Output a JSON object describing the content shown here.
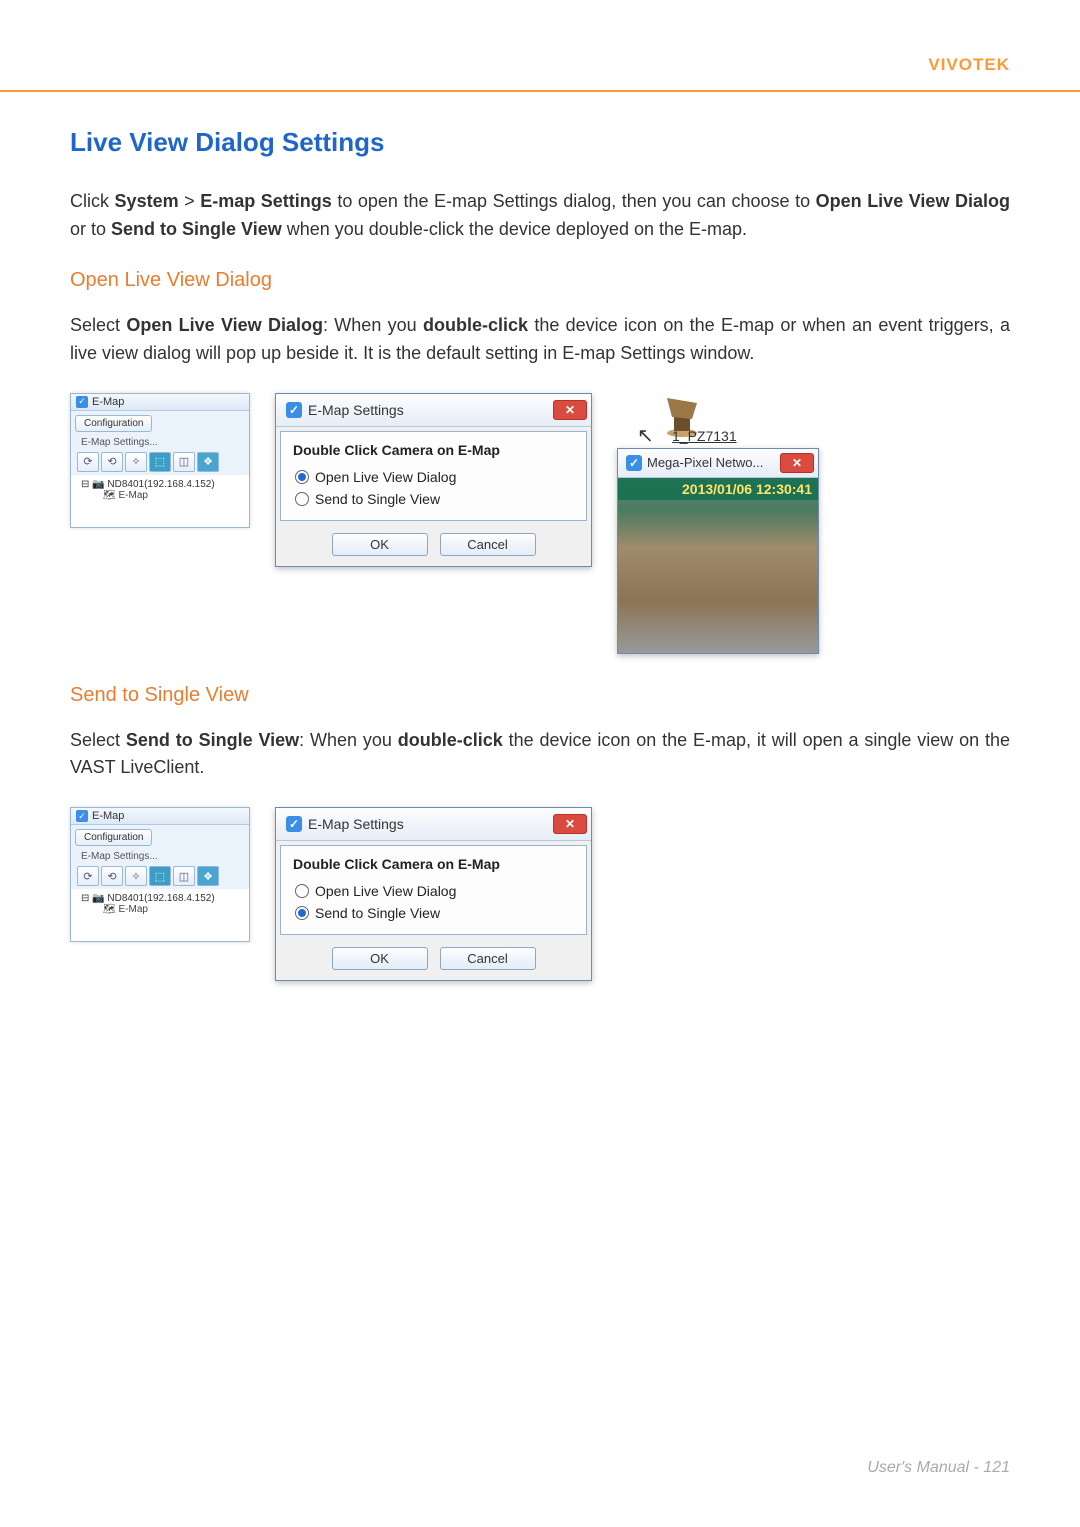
{
  "brand": "VIVOTEK",
  "title": "Live View Dialog Settings",
  "intro": {
    "p1_prefix": "Click ",
    "p1_bold1": "System",
    "p1_gt": " > ",
    "p1_bold2": "E-map Settings",
    "p1_mid": " to open the E-map Settings dialog, then you can choose to ",
    "p1_bold3": "Open Live View Dialog",
    "p1_or": " or to ",
    "p1_bold4": "Send to Single View",
    "p1_end": " when you double-click the device deployed on the E-map."
  },
  "section1": {
    "heading": "Open Live View Dialog",
    "p_prefix": "Select ",
    "p_bold1": "Open Live View Dialog",
    "p_mid1": ": When you ",
    "p_bold2": "double-click",
    "p_end": " the device icon on the E-map or when an event triggers, a live view dialog will pop up beside it. It is the default setting in E-map Settings window."
  },
  "section2": {
    "heading": "Send to Single View",
    "p_prefix": "Select ",
    "p_bold1": "Send to Single View",
    "p_mid1": ": When you ",
    "p_bold2": "double-click",
    "p_end": " the device icon on the E-map, it will open a single view on the VAST LiveClient."
  },
  "emapPane": {
    "title": "E-Map",
    "config": "Configuration",
    "sub": "E-Map Settings...",
    "tree_root": "ND8401(192.168.4.152)",
    "tree_child": "E-Map"
  },
  "dialog": {
    "title": "E-Map Settings",
    "group": "Double Click Camera on E-Map",
    "opt1": "Open Live View Dialog",
    "opt2": "Send to Single View",
    "ok": "OK",
    "cancel": "Cancel"
  },
  "liveview": {
    "camera_label": "1_PZ7131",
    "title": "Mega-Pixel Netwo...",
    "timestamp": "2013/01/06 12:30:41"
  },
  "footer": "User's Manual - 121"
}
